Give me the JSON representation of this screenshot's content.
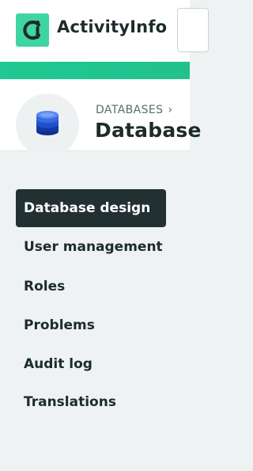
{
  "app": {
    "name": "ActivityInfo"
  },
  "breadcrumb": {
    "parent": "DATABASES",
    "separator": "›"
  },
  "page": {
    "title": "Database"
  },
  "nav": {
    "items": [
      {
        "label": "Database design",
        "active": true
      },
      {
        "label": "User management",
        "active": false
      },
      {
        "label": "Roles",
        "active": false
      },
      {
        "label": "Problems",
        "active": false
      },
      {
        "label": "Audit log",
        "active": false
      },
      {
        "label": "Translations",
        "active": false
      }
    ]
  },
  "colors": {
    "brand": "#3ed5a0",
    "accent_bar": "#1fc991",
    "active_nav": "#233032",
    "db_icon": "#1f4fcf"
  }
}
